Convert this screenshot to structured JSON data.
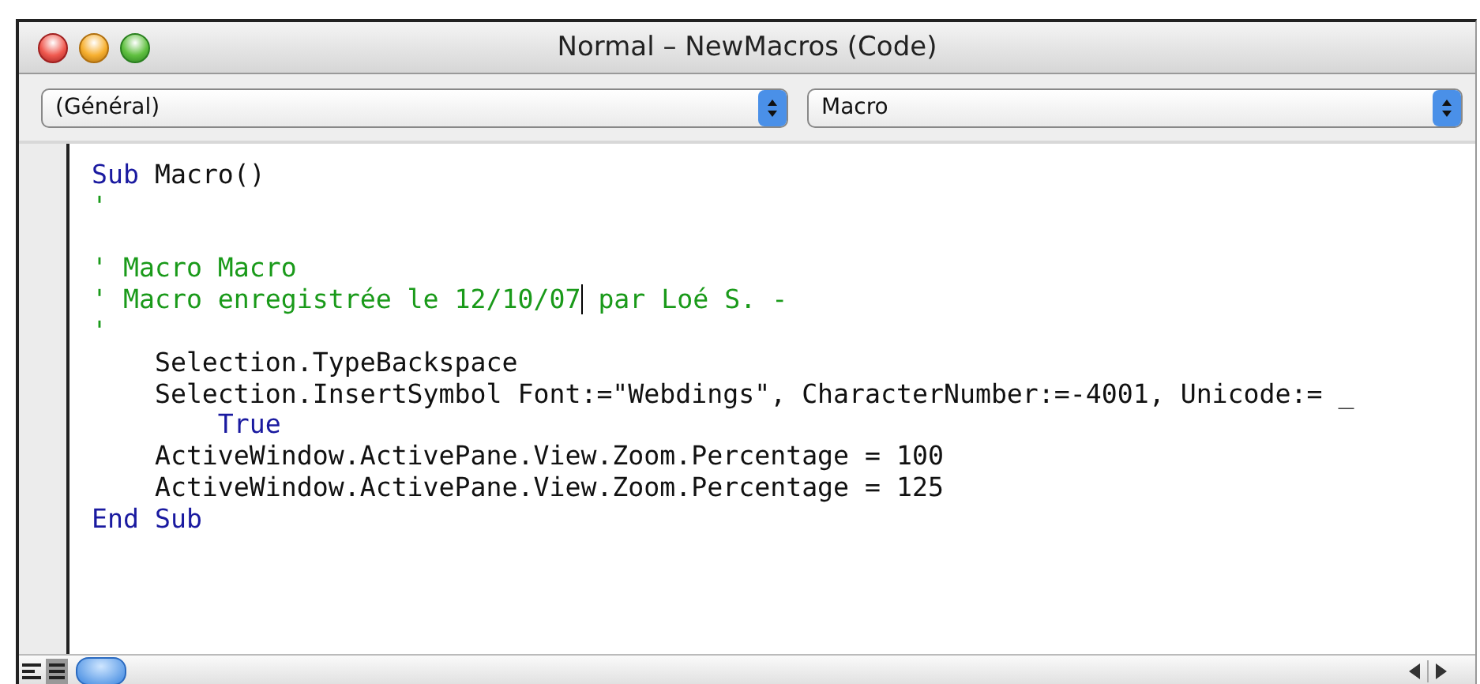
{
  "window": {
    "title": "Normal – NewMacros (Code)"
  },
  "dropdowns": [
    {
      "value": "(Général)"
    },
    {
      "value": "Macro"
    }
  ],
  "code_lines": [
    {
      "kind": "text",
      "segments": [
        {
          "kind": "keyword",
          "text": "Sub"
        },
        {
          "kind": "code",
          "text": " Macro()"
        }
      ]
    },
    {
      "kind": "text",
      "segments": [
        {
          "kind": "comment",
          "text": "'"
        }
      ]
    },
    {
      "kind": "blank"
    },
    {
      "kind": "text",
      "segments": [
        {
          "kind": "comment",
          "text": "' Macro Macro"
        }
      ]
    },
    {
      "kind": "text",
      "segments": [
        {
          "kind": "comment",
          "text": "' Macro enregistrée le 12/10/07"
        },
        {
          "kind": "caret"
        },
        {
          "kind": "comment",
          "text": " par Loé S. -"
        }
      ]
    },
    {
      "kind": "text",
      "segments": [
        {
          "kind": "comment",
          "text": "'"
        }
      ]
    },
    {
      "kind": "text",
      "segments": [
        {
          "kind": "code",
          "text": "    Selection.TypeBackspace"
        }
      ]
    },
    {
      "kind": "text",
      "segments": [
        {
          "kind": "code",
          "text": "    Selection.InsertSymbol Font:=\"Webdings\", CharacterNumber:=-4001, Unicode:= _"
        }
      ]
    },
    {
      "kind": "text",
      "segments": [
        {
          "kind": "keyword",
          "text": "        True"
        }
      ]
    },
    {
      "kind": "text",
      "segments": [
        {
          "kind": "code",
          "text": "    ActiveWindow.ActivePane.View.Zoom.Percentage = 100"
        }
      ]
    },
    {
      "kind": "text",
      "segments": [
        {
          "kind": "code",
          "text": "    ActiveWindow.ActivePane.View.Zoom.Percentage = 125"
        }
      ]
    },
    {
      "kind": "text",
      "segments": [
        {
          "kind": "keyword",
          "text": "End Sub"
        }
      ]
    }
  ]
}
